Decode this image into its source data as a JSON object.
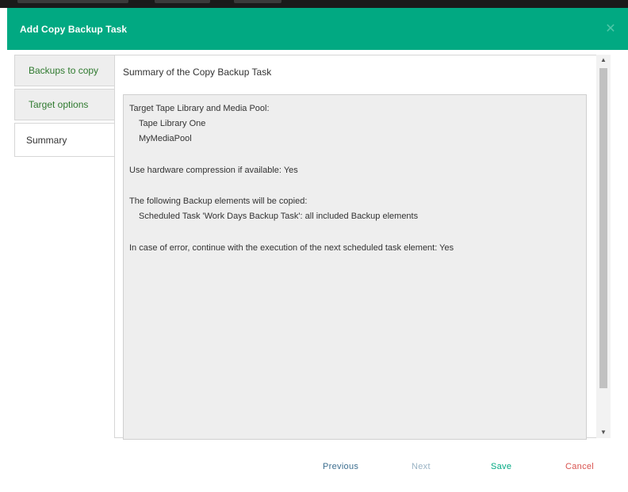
{
  "dialog": {
    "title": "Add Copy Backup Task",
    "close_icon": "close-icon"
  },
  "steps": [
    {
      "label": "Backups to copy",
      "state": "done"
    },
    {
      "label": "Target options",
      "state": "done"
    },
    {
      "label": "Summary",
      "state": "current"
    }
  ],
  "content": {
    "heading": "Summary of the Copy Backup Task",
    "summary_lines": [
      "Target Tape Library and Media Pool:",
      "Tape Library One",
      "MyMediaPool",
      "Use hardware compression if available: Yes",
      "The following Backup elements will be copied:",
      "Scheduled Task 'Work Days Backup Task': all included Backup elements",
      "In case of error, continue with the execution of the next scheduled task element: Yes"
    ]
  },
  "footer": {
    "previous_label": "Previous",
    "next_label": "Next",
    "save_label": "Save",
    "cancel_label": "Cancel"
  },
  "colors": {
    "header": "#01a982",
    "step_done_text": "#2f7a2f",
    "previous": "#3c6e8f",
    "next_disabled": "#9ab3c4",
    "save": "#01a982",
    "cancel": "#d9534f"
  }
}
